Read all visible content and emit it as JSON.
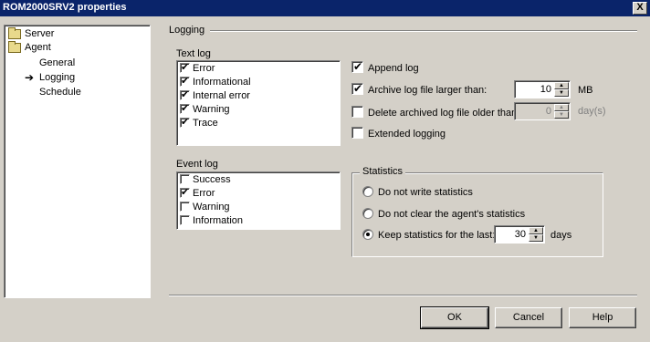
{
  "window": {
    "title": "ROM2000SRV2 properties",
    "close_label": "X"
  },
  "tree": {
    "items": [
      {
        "label": "Server",
        "icon": "folder-icon"
      },
      {
        "label": "Agent",
        "icon": "folder-open-icon"
      },
      {
        "label": "General"
      },
      {
        "label": "Logging",
        "icon": "arrow-icon",
        "selected": true
      },
      {
        "label": "Schedule"
      }
    ]
  },
  "section": {
    "title": "Logging"
  },
  "text_log": {
    "label": "Text log",
    "items": [
      {
        "label": "Error",
        "checked": true
      },
      {
        "label": "Informational",
        "checked": true
      },
      {
        "label": "Internal error",
        "checked": true
      },
      {
        "label": "Warning",
        "checked": true
      },
      {
        "label": "Trace",
        "checked": true
      }
    ]
  },
  "event_log": {
    "label": "Event log",
    "items": [
      {
        "label": "Success",
        "checked": false
      },
      {
        "label": "Error",
        "checked": true
      },
      {
        "label": "Warning",
        "checked": false
      },
      {
        "label": "Information",
        "checked": false
      }
    ]
  },
  "options": {
    "append_log": {
      "label": "Append log",
      "checked": true
    },
    "archive": {
      "label": "Archive log file larger than:",
      "checked": true,
      "value": "10",
      "unit": "MB"
    },
    "delete_archived": {
      "label": "Delete archived log file older than",
      "checked": false,
      "value": "0",
      "unit": "day(s)"
    },
    "extended_logging": {
      "label": "Extended logging",
      "checked": false
    }
  },
  "statistics": {
    "label": "Statistics",
    "options": [
      {
        "label": "Do not write statistics",
        "selected": false
      },
      {
        "label": "Do not clear the agent's statistics",
        "selected": false
      },
      {
        "label": "Keep statistics for the last:",
        "selected": true
      }
    ],
    "days_value": "30",
    "days_unit": "days"
  },
  "buttons": {
    "ok": "OK",
    "cancel": "Cancel",
    "help": "Help"
  }
}
